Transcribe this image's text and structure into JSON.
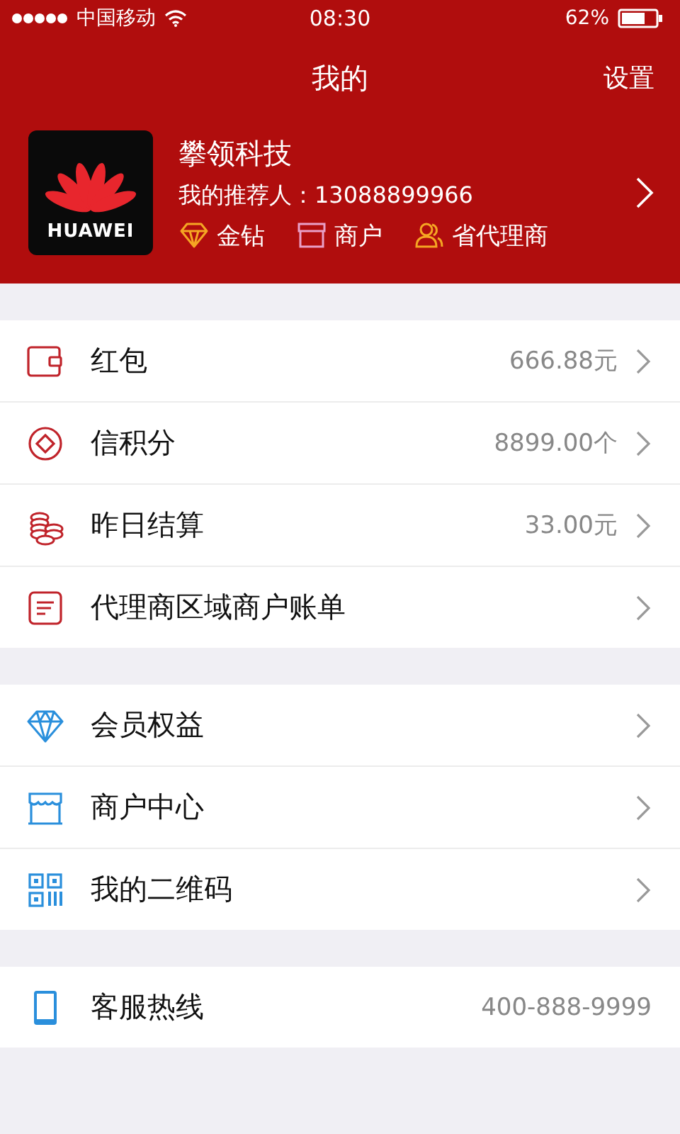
{
  "status_bar": {
    "carrier": "中国移动",
    "time": "08:30",
    "battery": "62%"
  },
  "nav": {
    "title": "我的",
    "action": "设置"
  },
  "profile": {
    "logo_text": "HUAWEI",
    "name": "攀领科技",
    "referrer": "我的推荐人：13088899966",
    "badges": [
      {
        "kind": "diamond",
        "label": "金钻"
      },
      {
        "kind": "shop",
        "label": "商户"
      },
      {
        "kind": "people",
        "label": "省代理商"
      }
    ]
  },
  "groups": [
    [
      {
        "kind": "wallet",
        "label": "红包",
        "value": "666.88元",
        "chevron": true
      },
      {
        "kind": "coin",
        "label": "信积分",
        "value": "8899.00个",
        "chevron": true
      },
      {
        "kind": "coins",
        "label": "昨日结算",
        "value": "33.00元",
        "chevron": true
      },
      {
        "kind": "bill",
        "label": "代理商区域商户账单",
        "chevron": true
      }
    ],
    [
      {
        "kind": "diamond",
        "label": "会员权益",
        "chevron": true
      },
      {
        "kind": "shop",
        "label": "商户中心",
        "chevron": true
      },
      {
        "kind": "qrcode",
        "label": "我的二维码",
        "chevron": true
      }
    ],
    [
      {
        "kind": "phone",
        "label": "客服热线",
        "value": "400-888-9999",
        "chevron": false
      }
    ]
  ]
}
